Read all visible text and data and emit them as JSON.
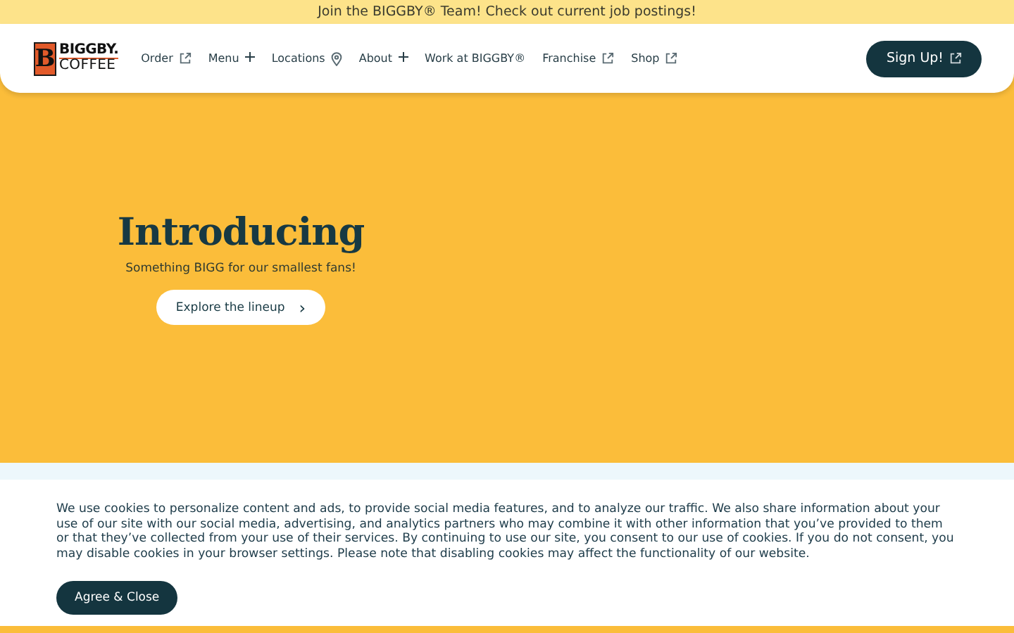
{
  "announcement": "Join the BIGGBY® Team! Check out current job postings!",
  "logo": {
    "mark": "B",
    "name": "BIGGBY.",
    "sub": "COFFEE"
  },
  "nav": [
    {
      "label": "Order",
      "kind": "external"
    },
    {
      "label": "Menu",
      "kind": "dropdown",
      "expanded": false
    },
    {
      "label": "Locations",
      "kind": "location"
    },
    {
      "label": "About",
      "kind": "dropdown",
      "expanded": false
    },
    {
      "label": "Work at BIGGBY®",
      "kind": "plain"
    },
    {
      "label": "Franchise",
      "kind": "external"
    },
    {
      "label": "Shop",
      "kind": "external"
    }
  ],
  "signup": {
    "label": "Sign Up!",
    "kind": "external"
  },
  "hero": {
    "title": "Introducing",
    "subtitle": "Something BIGG for our smallest fans!",
    "button": "Explore the lineup",
    "button_icon": "›"
  },
  "cookie": {
    "text": "We use cookies to personalize content and ads, to provide social media features, and to analyze our traffic. We also share information about your use of our site with our social media, advertising, and analytics partners who may combine it with other information that you’ve provided to them or that they’ve collected from your use of their services. By continuing to use our site, you consent to our use of cookies. If you do not consent, you may disable cookies in your browser settings. Please note that disabling cookies may affect the functionality of our website.",
    "button": "Agree & Close"
  }
}
